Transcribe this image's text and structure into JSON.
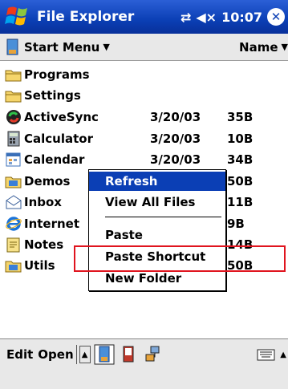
{
  "titlebar": {
    "app_title": "File Explorer",
    "time": "10:07",
    "close_label": "✕",
    "connectivity_icon": "connectivity-icon",
    "volume_icon": "volume-icon"
  },
  "folderbar": {
    "folder_label": "Start Menu",
    "sort_label": "Name"
  },
  "files": [
    {
      "name": "Programs",
      "date": "",
      "size": "",
      "icon": "folder-icon"
    },
    {
      "name": "Settings",
      "date": "",
      "size": "",
      "icon": "folder-icon"
    },
    {
      "name": "ActiveSync",
      "date": "3/20/03",
      "size": "35B",
      "icon": "activesync-icon"
    },
    {
      "name": "Calculator",
      "date": "3/20/03",
      "size": "10B",
      "icon": "calculator-icon"
    },
    {
      "name": "Calendar",
      "date": "3/20/03",
      "size": "34B",
      "icon": "calendar-icon"
    },
    {
      "name": "Demos",
      "date": "",
      "size": "50B",
      "icon": "demos-folder-icon"
    },
    {
      "name": "Inbox",
      "date": "",
      "size": "11B",
      "icon": "inbox-icon"
    },
    {
      "name": "Internet",
      "date": "",
      "size": "9B",
      "icon": "internet-explorer-icon"
    },
    {
      "name": "Notes",
      "date": "",
      "size": "14B",
      "icon": "notes-icon"
    },
    {
      "name": "Utils",
      "date": "",
      "size": "50B",
      "icon": "utils-folder-icon"
    }
  ],
  "context_menu": {
    "items": [
      "Refresh",
      "View All Files",
      "Paste",
      "Paste Shortcut",
      "New Folder"
    ]
  },
  "bottombar": {
    "edit_label": "Edit",
    "open_label": "Open",
    "arrow_label": "▲"
  },
  "colors": {
    "titlebar": "#0b3fb5",
    "menu_highlight": "#0b3fb5",
    "annotation_box": "#e0141e"
  }
}
